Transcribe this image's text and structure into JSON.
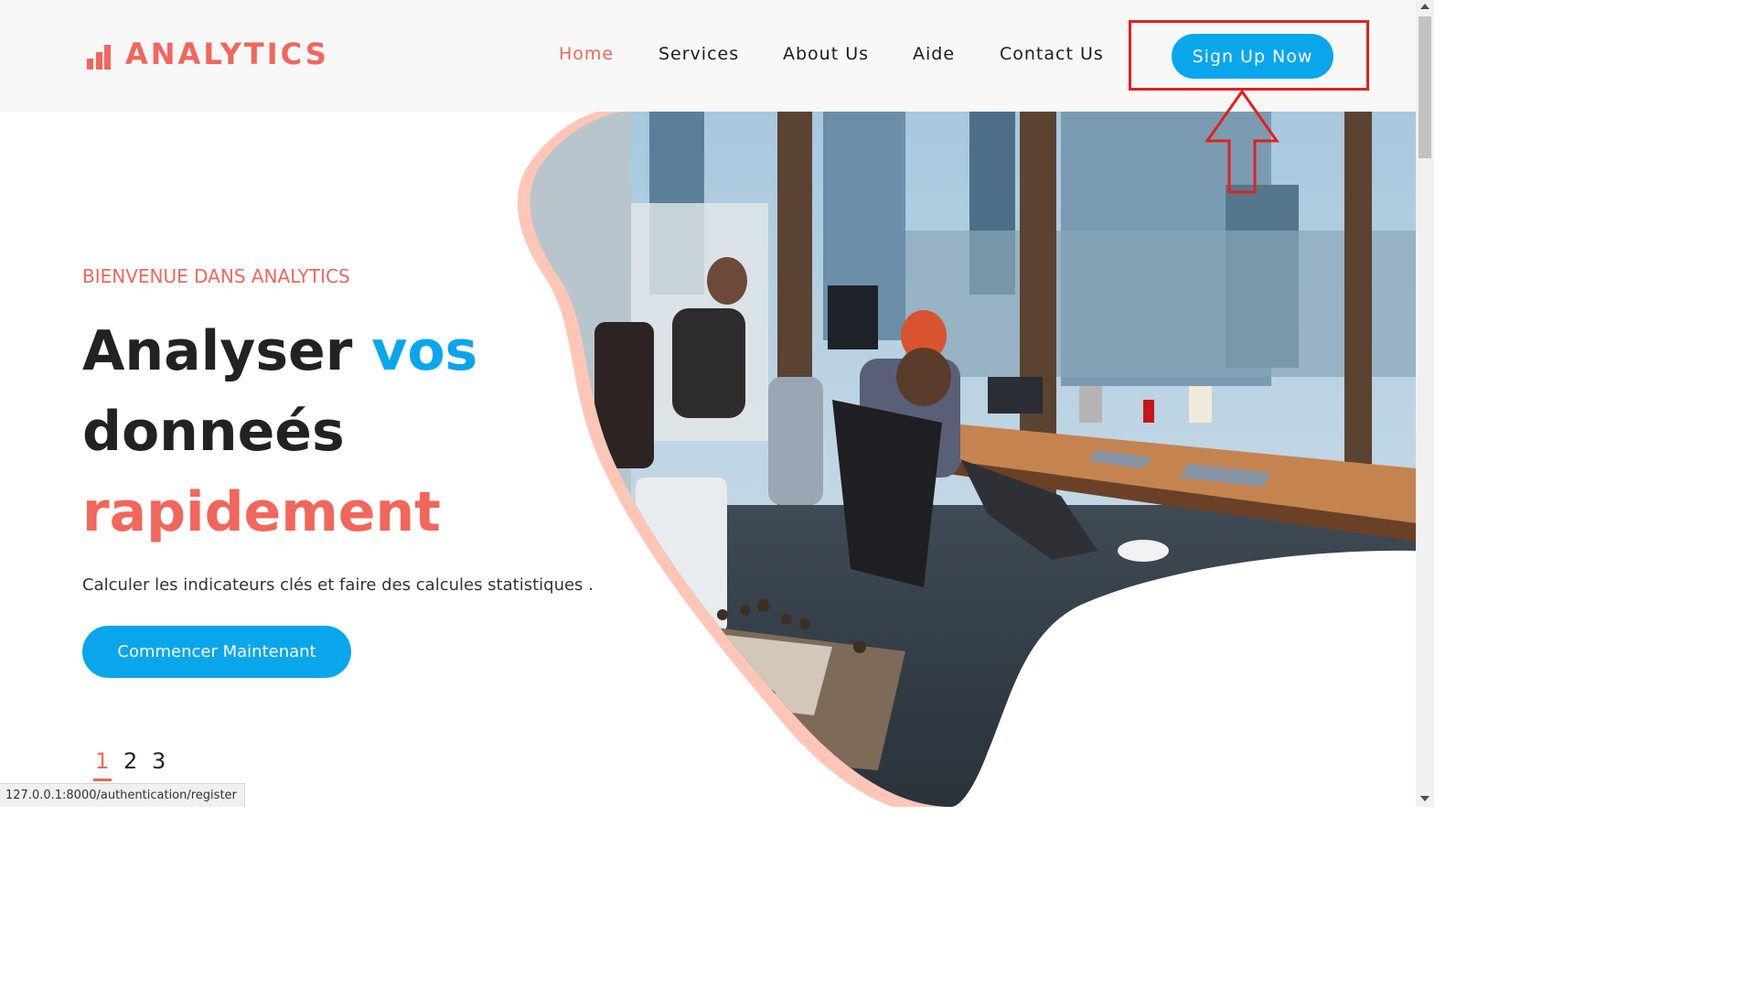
{
  "brand": {
    "name": "ANALYTICS",
    "logo_icon": "bar-chart-icon",
    "accent_color": "#f2665b"
  },
  "nav": {
    "items": [
      {
        "label": "Home",
        "active": true
      },
      {
        "label": "Services",
        "active": false
      },
      {
        "label": "About Us",
        "active": false
      },
      {
        "label": "Aide",
        "active": false
      },
      {
        "label": "Contact Us",
        "active": false
      }
    ],
    "signup_label": "Sign Up Now",
    "button_color": "#09a6ec"
  },
  "hero": {
    "eyebrow": "BIENVENUE DANS ANALYTICS",
    "title_part1": "Analyser ",
    "title_part2": "vos",
    "title_part3": "donneés",
    "title_part4": "rapidement",
    "description": "Calculer les indicateurs clés et faire des calcules statistiques .",
    "cta_label": "Commencer Maintenant",
    "image_subject": "office workers at desks with chessboard"
  },
  "pager": {
    "pages": [
      "1",
      "2",
      "3"
    ],
    "active_index": 0
  },
  "annotation": {
    "highlight_color": "#e2211c",
    "arrow_icon": "arrow-up-icon"
  },
  "statusbar": {
    "url": "127.0.0.1:8000/authentication/register"
  }
}
